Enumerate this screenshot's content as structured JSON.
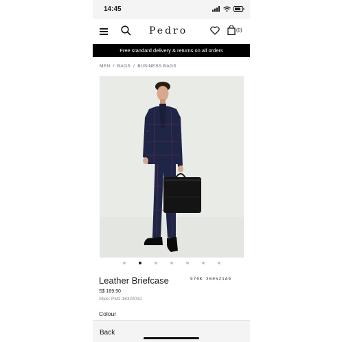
{
  "status_bar": {
    "time": "14:45"
  },
  "header": {
    "logo": "Pedro",
    "bag_count": "(0)"
  },
  "banner": {
    "text": "Free standard delivery & returns on all orders"
  },
  "breadcrumb": {
    "items": [
      "MEN",
      "BAGS",
      "BUSINESS BAGS"
    ],
    "separator": "/"
  },
  "gallery": {
    "total_images": 7,
    "active_index": 1
  },
  "product": {
    "title": "Leather Briefcase",
    "code": "970K 260521A9",
    "price": "S$ 189.90",
    "style": "Style: PM2-16320032",
    "colour_label": "Colour"
  },
  "bottom": {
    "back_label": "Back"
  },
  "colors": {
    "banner_bg": "#000000",
    "suit": "#1f2547",
    "background": "#e9ebe7"
  }
}
